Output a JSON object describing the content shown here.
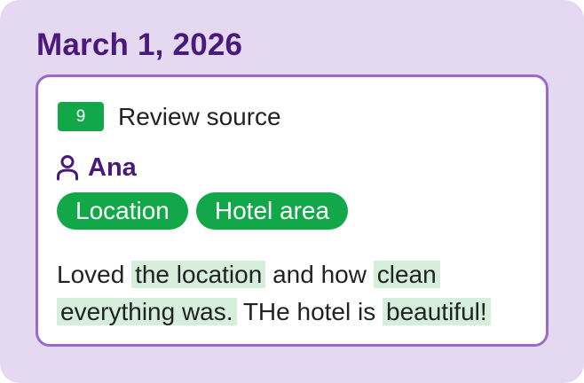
{
  "date": "March 1, 2026",
  "review": {
    "score": "9",
    "source_label": "Review source",
    "reviewer_name": "Ana",
    "tags": [
      "Location",
      "Hotel area"
    ],
    "text": {
      "p1": "Loved ",
      "h1": "the location",
      "p2": " and how ",
      "h2": "clean",
      "h3": "everything was.",
      "p3": " THe hotel is ",
      "h4": "beautiful!"
    }
  },
  "colors": {
    "background": "#e5d9f1",
    "card_border": "#9b6ac9",
    "accent_purple": "#4a1a7a",
    "green": "#12a84a",
    "highlight": "#d5efdc"
  },
  "icons": {
    "reviewer": "person-icon"
  }
}
